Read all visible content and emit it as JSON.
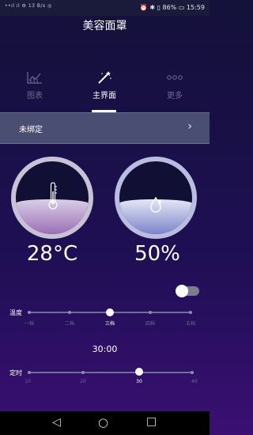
{
  "status": {
    "left": "••ıl ıl ⚙ 13 B/s ◎",
    "right": "⏰ ✱ ▯ 86% ▭ 15:59"
  },
  "title": "美容面罩",
  "tabs": [
    {
      "label": "图表",
      "icon": "chart-icon"
    },
    {
      "label": "主界面",
      "icon": "magic-wand-icon"
    },
    {
      "label": "更多",
      "icon": "more-dots-icon"
    }
  ],
  "bind": {
    "label": "未绑定",
    "chevron": "›"
  },
  "temperature": {
    "value": "28°C",
    "icon": "thermometer-icon",
    "level": 0.48
  },
  "humidity": {
    "value": "50%",
    "icon": "water-drop-icon",
    "level": 0.48
  },
  "toggle": {
    "state": "off"
  },
  "level_slider": {
    "label": "温度",
    "options": [
      "一档",
      "二档",
      "三档",
      "四档",
      "五档"
    ],
    "selected_index": 2
  },
  "time_display": "30:00",
  "timer_slider": {
    "label": "定时",
    "options": [
      "10",
      "20",
      "30",
      "40"
    ],
    "selected_index": 2
  },
  "nav": {
    "back": "◁",
    "home": "○",
    "recent": "□"
  }
}
